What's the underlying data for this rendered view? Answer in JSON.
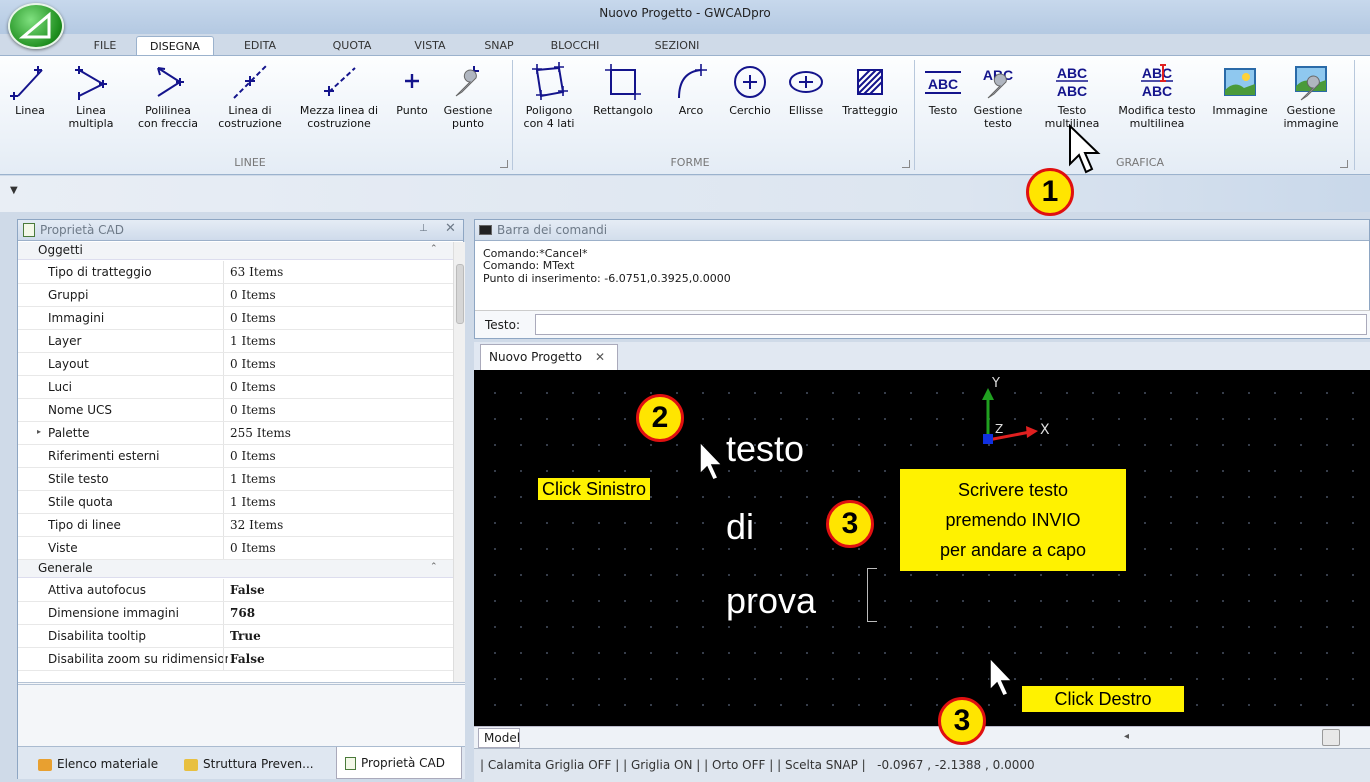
{
  "window": {
    "title": "Nuovo Progetto - GWCADpro"
  },
  "tabs": [
    "FILE",
    "DISEGNA",
    "EDITA",
    "QUOTA",
    "VISTA",
    "SNAP",
    "BLOCCHI",
    "SEZIONI"
  ],
  "ribbon": {
    "linee": {
      "label": "LINEE",
      "buttons": [
        {
          "l1": "Linea",
          "l2": "",
          "icon": "line-icon"
        },
        {
          "l1": "Linea",
          "l2": "multipla",
          "icon": "multiline-icon"
        },
        {
          "l1": "Polilinea",
          "l2": "con freccia",
          "icon": "polyline-arrow-icon"
        },
        {
          "l1": "Linea di",
          "l2": "costruzione",
          "icon": "construction-line-icon"
        },
        {
          "l1": "Mezza linea di",
          "l2": "costruzione",
          "icon": "ray-line-icon"
        },
        {
          "l1": "Punto",
          "l2": "",
          "icon": "point-icon"
        },
        {
          "l1": "Gestione",
          "l2": "punto",
          "icon": "point-manager-icon"
        }
      ]
    },
    "forme": {
      "label": "FORME",
      "buttons": [
        {
          "l1": "Poligono",
          "l2": "con 4 lati",
          "icon": "polygon-icon"
        },
        {
          "l1": "Rettangolo",
          "l2": "",
          "icon": "rectangle-icon"
        },
        {
          "l1": "Arco",
          "l2": "",
          "icon": "arc-icon"
        },
        {
          "l1": "Cerchio",
          "l2": "",
          "icon": "circle-icon"
        },
        {
          "l1": "Ellisse",
          "l2": "",
          "icon": "ellipse-icon"
        },
        {
          "l1": "Tratteggio",
          "l2": "",
          "icon": "hatch-icon"
        }
      ]
    },
    "grafica": {
      "label": "GRAFICA",
      "buttons": [
        {
          "l1": "Testo",
          "l2": "",
          "icon": "text-icon"
        },
        {
          "l1": "Gestione",
          "l2": "testo",
          "icon": "text-manager-icon"
        },
        {
          "l1": "Testo",
          "l2": "multilinea",
          "icon": "multiline-text-icon"
        },
        {
          "l1": "Modifica testo",
          "l2": "multilinea",
          "icon": "edit-multiline-text-icon"
        },
        {
          "l1": "Immagine",
          "l2": "",
          "icon": "image-icon"
        },
        {
          "l1": "Gestione",
          "l2": "immagine",
          "icon": "image-manager-icon"
        }
      ]
    }
  },
  "properties": {
    "title": "Proprietà CAD",
    "cat_oggetti": "Oggetti",
    "oggetti": [
      {
        "k": "Tipo di tratteggio",
        "v": "63 Items"
      },
      {
        "k": "Gruppi",
        "v": "0 Items"
      },
      {
        "k": "Immagini",
        "v": "0 Items"
      },
      {
        "k": "Layer",
        "v": "1 Items"
      },
      {
        "k": "Layout",
        "v": "0 Items"
      },
      {
        "k": "Luci",
        "v": "0 Items"
      },
      {
        "k": "Nome UCS",
        "v": "0 Items"
      },
      {
        "k": "Palette",
        "v": "255 Items"
      },
      {
        "k": "Riferimenti esterni",
        "v": "0 Items"
      },
      {
        "k": "Stile testo",
        "v": "1 Items"
      },
      {
        "k": "Stile quota",
        "v": "1 Items"
      },
      {
        "k": "Tipo di linee",
        "v": "32 Items"
      },
      {
        "k": "Viste",
        "v": "0 Items"
      }
    ],
    "cat_generale": "Generale",
    "generale": [
      {
        "k": "Attiva autofocus",
        "v": "False"
      },
      {
        "k": "Dimensione immagini",
        "v": "768"
      },
      {
        "k": "Disabilita tooltip",
        "v": "True"
      },
      {
        "k": "Disabilita zoom su ridimension",
        "v": "False"
      }
    ]
  },
  "bottom_tabs": [
    "Elenco materiale",
    "Struttura Preven...",
    "Proprietà CAD"
  ],
  "command": {
    "title": "Barra dei comandi",
    "lines": [
      "Comando:*Cancel*",
      "Comando: MText",
      "Punto di inserimento: -6.0751,0.3925,0.0000"
    ],
    "input_label": "Testo:",
    "input_value": ""
  },
  "doc_tab": "Nuovo Progetto",
  "canvas": {
    "text_lines": [
      "testo",
      "di",
      "prova"
    ],
    "axis_y": "Y",
    "axis_x": "X",
    "axis_z": "Z"
  },
  "annotations": {
    "c1": "1",
    "c2": "2",
    "c3a": "3",
    "c3b": "3",
    "click_left": "Click Sinistro",
    "click_right": "Click Destro",
    "instr1": "Scrivere testo",
    "instr2": "premendo INVIO",
    "instr3": "per andare a capo"
  },
  "model_tab": "Model",
  "status": "| Calamita Griglia OFF | | Griglia ON | | Orto OFF | | Scelta SNAP |   -0.0967 , -2.1388 , 0.0000",
  "colors": {
    "accent": "#ffe500",
    "callout_border": "#e01010",
    "axis_x": "#e02020",
    "axis_y": "#20a020"
  }
}
